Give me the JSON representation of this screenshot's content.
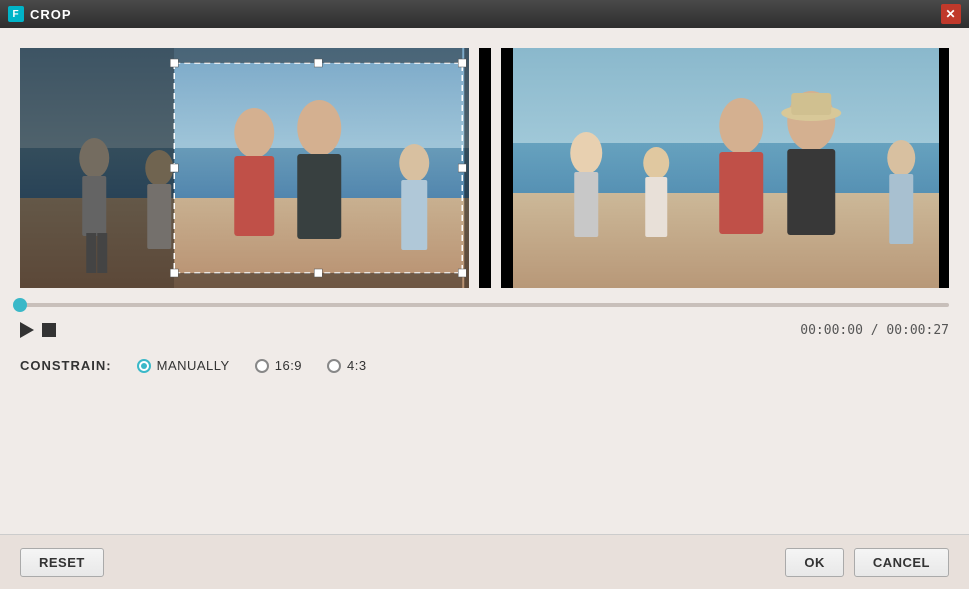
{
  "titleBar": {
    "title": "CROP",
    "iconText": "F"
  },
  "panels": {
    "left": {
      "description": "Beach scene with crop selection overlay"
    },
    "right": {
      "description": "Beach scene preview after crop"
    }
  },
  "timeline": {
    "currentTime": "00:00:00",
    "totalTime": "00:00:27",
    "timeDisplay": "00:00:00 / 00:00:27",
    "progress": 0
  },
  "constrain": {
    "label": "CONSTRAIN:",
    "options": [
      {
        "value": "MANUALLY",
        "selected": true
      },
      {
        "value": "16:9",
        "selected": false
      },
      {
        "value": "4:3",
        "selected": false
      }
    ]
  },
  "buttons": {
    "reset": "RESET",
    "ok": "OK",
    "cancel": "CANCEL"
  },
  "playback": {
    "playLabel": "play",
    "stopLabel": "stop"
  }
}
